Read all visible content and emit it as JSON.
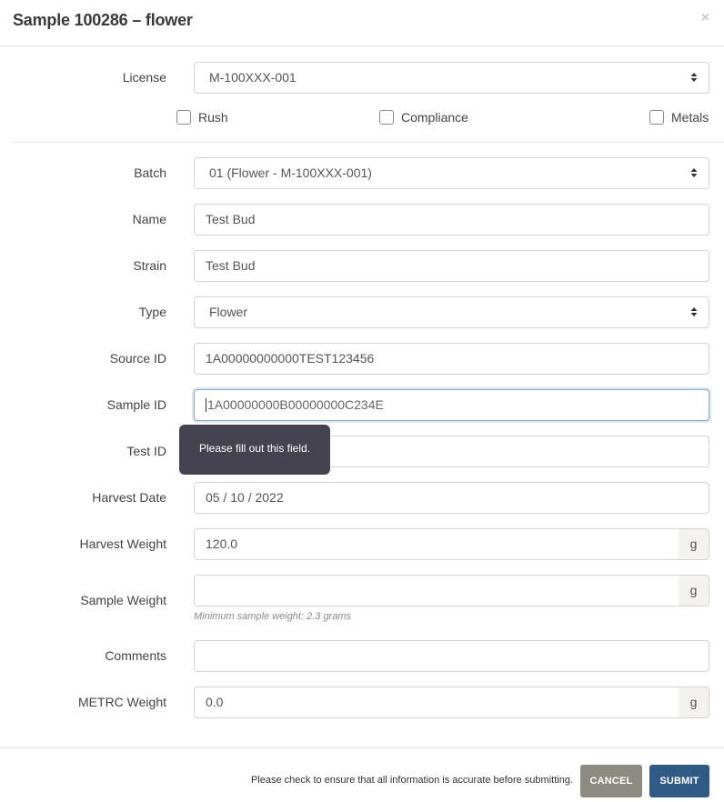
{
  "modal": {
    "title": "Sample 100286 – flower",
    "close_label": "×"
  },
  "license": {
    "label": "License",
    "value": "M-100XXX-001"
  },
  "checkboxes": [
    {
      "label": "Rush",
      "checked": false
    },
    {
      "label": "Compliance",
      "checked": false
    },
    {
      "label": "Metals",
      "checked": false
    }
  ],
  "fields": {
    "batch": {
      "label": "Batch",
      "value": "01 (Flower - M-100XXX-001)"
    },
    "name": {
      "label": "Name",
      "value": "Test Bud"
    },
    "strain": {
      "label": "Strain",
      "value": "Test Bud"
    },
    "type": {
      "label": "Type",
      "value": "Flower"
    },
    "source_id": {
      "label": "Source ID",
      "value": "1A00000000000TEST123456"
    },
    "sample_id": {
      "label": "Sample ID",
      "value": "1A00000000B00000000C234E"
    },
    "test_id": {
      "label": "Test ID",
      "value": ""
    },
    "harvest_date": {
      "label": "Harvest Date",
      "value": "05 / 10 / 2022"
    },
    "harvest_weight": {
      "label": "Harvest Weight",
      "value": "120.0",
      "unit": "g"
    },
    "sample_weight": {
      "label": "Sample Weight",
      "value": "",
      "unit": "g",
      "help": "Minimum sample weight: 2.3 grams"
    },
    "comments": {
      "label": "Comments",
      "value": ""
    },
    "metrc_weight": {
      "label": "METRC Weight",
      "value": "0.0",
      "unit": "g"
    }
  },
  "tooltip": {
    "text": "Please fill out this field."
  },
  "footer": {
    "note": "Please check to ensure that all information is accurate before submitting.",
    "cancel_label": "CANCEL",
    "submit_label": "SUBMIT"
  },
  "colors": {
    "submit": "#2f5b86",
    "cancel": "#8d8983",
    "tooltip": "#45434f"
  }
}
